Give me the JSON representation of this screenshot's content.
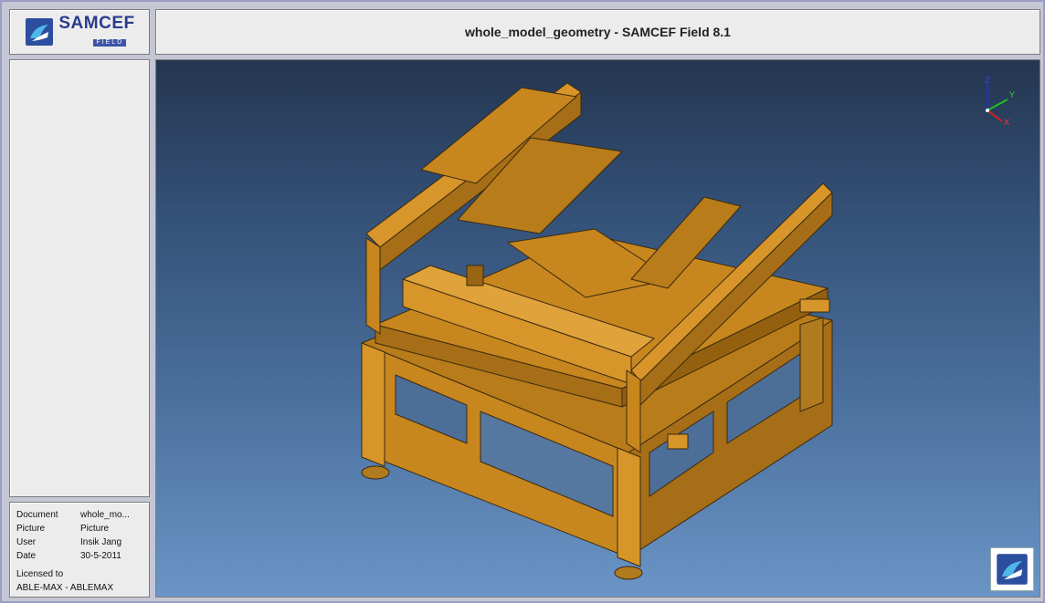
{
  "header": {
    "brand": "SAMCEF",
    "brand_sub": "FIELD",
    "title": "whole_model_geometry - SAMCEF Field 8.1"
  },
  "info": {
    "rows": [
      {
        "key": "Document",
        "value": "whole_mo..."
      },
      {
        "key": "Picture",
        "value": "Picture"
      },
      {
        "key": "User",
        "value": "Insik Jang"
      },
      {
        "key": "Date",
        "value": "30-5-2011"
      }
    ],
    "licensed_label": "Licensed to",
    "licensed_value": "ABLE-MAX - ABLEMAX"
  },
  "axes": {
    "z": "Z",
    "y": "Y",
    "x": "X",
    "colors": {
      "z": "#2b2bd6",
      "y": "#21c021",
      "x": "#d62020"
    }
  },
  "model": {
    "body_color": "#c8861e",
    "shade_color": "#9a6512",
    "edge_color": "#3a2a10"
  },
  "icons": [
    "samcef-logo-icon",
    "samcef-corner-logo-icon",
    "axis-triad-icon"
  ]
}
